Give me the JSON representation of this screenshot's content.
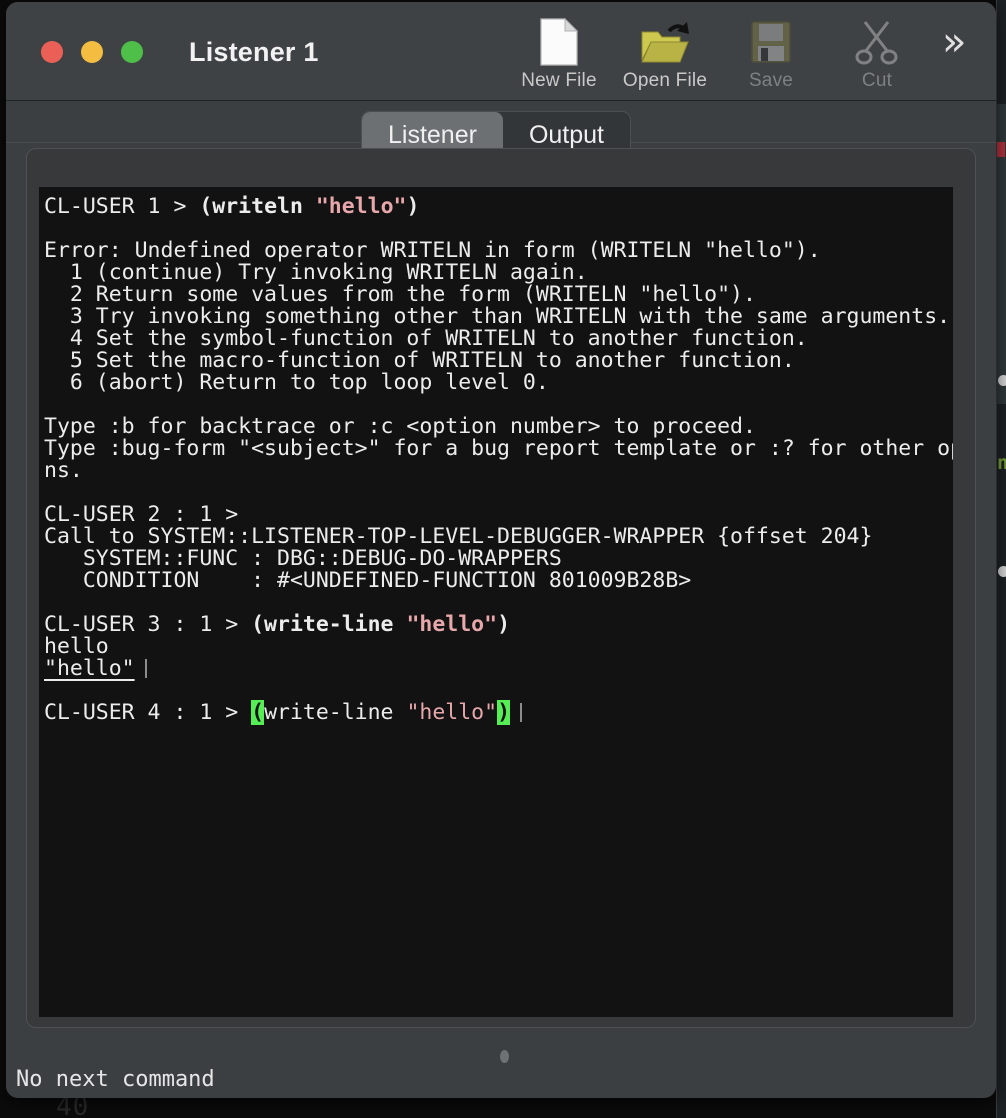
{
  "window": {
    "title": "Listener 1",
    "traffic_lights": [
      {
        "name": "close",
        "color": "#ea6056"
      },
      {
        "name": "minimize",
        "color": "#f2bd41"
      },
      {
        "name": "maximize",
        "color": "#4ec04a"
      }
    ]
  },
  "toolbar": {
    "buttons": [
      {
        "label": "New File",
        "icon": "new-file-icon",
        "enabled": true
      },
      {
        "label": "Open File",
        "icon": "open-folder-icon",
        "enabled": true
      },
      {
        "label": "Save",
        "icon": "floppy-disk-icon",
        "enabled": false
      },
      {
        "label": "Cut",
        "icon": "scissors-icon",
        "enabled": false
      }
    ],
    "overflow_glyph": "»"
  },
  "tabs": [
    {
      "label": "Listener",
      "active": true
    },
    {
      "label": "Output",
      "active": false
    }
  ],
  "terminal": {
    "lines": [
      {
        "segments": [
          {
            "text": "CL-USER 1 > ",
            "style": "plain"
          },
          {
            "text": "(writeln ",
            "style": "bold"
          },
          {
            "text": "\"hello\"",
            "style": "string-bold"
          },
          {
            "text": ")",
            "style": "bold"
          }
        ]
      },
      {
        "segments": []
      },
      {
        "segments": [
          {
            "text": "Error: Undefined operator WRITELN in form (WRITELN \"hello\").",
            "style": "plain"
          }
        ]
      },
      {
        "segments": [
          {
            "text": "  1 (continue) Try invoking WRITELN again.",
            "style": "plain"
          }
        ]
      },
      {
        "segments": [
          {
            "text": "  2 Return some values from the form (WRITELN \"hello\").",
            "style": "plain"
          }
        ]
      },
      {
        "segments": [
          {
            "text": "  3 Try invoking something other than WRITELN with the same arguments.",
            "style": "plain"
          }
        ]
      },
      {
        "segments": [
          {
            "text": "  4 Set the symbol-function of WRITELN to another function.",
            "style": "plain"
          }
        ]
      },
      {
        "segments": [
          {
            "text": "  5 Set the macro-function of WRITELN to another function.",
            "style": "plain"
          }
        ]
      },
      {
        "segments": [
          {
            "text": "  6 (abort) Return to top loop level 0.",
            "style": "plain"
          }
        ]
      },
      {
        "segments": []
      },
      {
        "segments": [
          {
            "text": "Type :b for backtrace or :c <option number> to proceed.",
            "style": "plain"
          }
        ]
      },
      {
        "segments": [
          {
            "text": "Type :bug-form \"<subject>\" for a bug report template or :? for other optio",
            "style": "plain"
          },
          {
            "text": "»",
            "style": "wrap-marker"
          }
        ]
      },
      {
        "segments": [
          {
            "text": "ns.",
            "style": "plain"
          }
        ]
      },
      {
        "segments": []
      },
      {
        "segments": [
          {
            "text": "CL-USER 2 : 1 >",
            "style": "plain"
          }
        ]
      },
      {
        "segments": [
          {
            "text": "Call to SYSTEM::LISTENER-TOP-LEVEL-DEBUGGER-WRAPPER {offset 204}",
            "style": "plain"
          }
        ]
      },
      {
        "segments": [
          {
            "text": "   SYSTEM::FUNC : DBG::DEBUG-DO-WRAPPERS",
            "style": "plain"
          }
        ]
      },
      {
        "segments": [
          {
            "text": "   CONDITION    : #<UNDEFINED-FUNCTION 801009B28B>",
            "style": "plain"
          }
        ]
      },
      {
        "segments": []
      },
      {
        "segments": [
          {
            "text": "CL-USER 3 : 1 > ",
            "style": "plain"
          },
          {
            "text": "(write-line ",
            "style": "bold"
          },
          {
            "text": "\"hello\"",
            "style": "string-bold"
          },
          {
            "text": ")",
            "style": "bold"
          }
        ]
      },
      {
        "segments": [
          {
            "text": "hello",
            "style": "plain"
          }
        ]
      },
      {
        "segments": [
          {
            "text": "\"hello\"",
            "style": "underline"
          },
          {
            "text": "",
            "style": "caret"
          }
        ]
      },
      {
        "segments": []
      },
      {
        "segments": [
          {
            "text": "CL-USER 4 : 1 > ",
            "style": "plain"
          },
          {
            "text": "(",
            "style": "paren-highlight"
          },
          {
            "text": "write-line ",
            "style": "plain"
          },
          {
            "text": "\"hello\"",
            "style": "string"
          },
          {
            "text": ")",
            "style": "paren-highlight"
          },
          {
            "text": "",
            "style": "caret"
          }
        ]
      }
    ]
  },
  "status": {
    "message": "No next command"
  },
  "background": {
    "peek_text": "40",
    "green_sliver": "n"
  },
  "colors": {
    "window_chrome": "#3c3f41",
    "terminal_bg": "#121212",
    "terminal_fg": "#ececec",
    "string_color": "#e8a8ab",
    "paren_highlight": "#55ee55",
    "wrap_marker": "#9a62d6",
    "active_tab": "#6d7072"
  }
}
